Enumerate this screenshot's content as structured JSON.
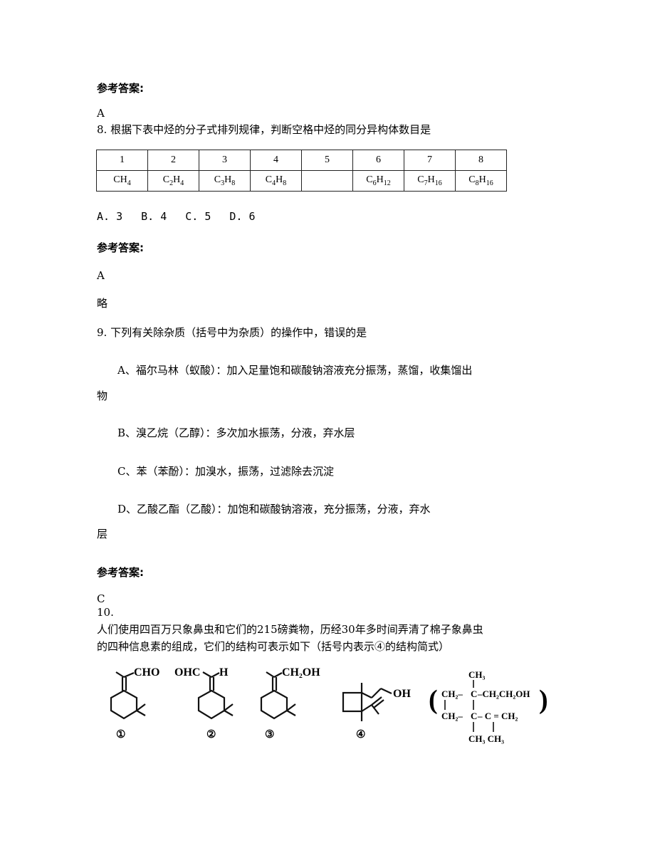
{
  "sections": {
    "ans7": {
      "heading": "参考答案:",
      "answer": "A"
    },
    "q8": {
      "stem": "8. 根据下表中烃的分子式排列规律，判断空格中烃的同分异构体数目是",
      "table": {
        "index_row": [
          "1",
          "2",
          "3",
          "4",
          "5",
          "6",
          "7",
          "8"
        ],
        "formula_row": [
          {
            "base": [
              "C",
              "H"
            ],
            "subs": [
              "",
              "4"
            ]
          },
          {
            "base": [
              "C",
              "H"
            ],
            "subs": [
              "2",
              "4"
            ]
          },
          {
            "base": [
              "C",
              "H"
            ],
            "subs": [
              "3",
              "8"
            ]
          },
          {
            "base": [
              "C",
              "H"
            ],
            "subs": [
              "4",
              "8"
            ]
          },
          null,
          {
            "base": [
              "C",
              "H"
            ],
            "subs": [
              "6",
              "12"
            ]
          },
          {
            "base": [
              "C",
              "H"
            ],
            "subs": [
              "7",
              "16"
            ]
          },
          {
            "base": [
              "C",
              "H"
            ],
            "subs": [
              "8",
              "16"
            ]
          }
        ]
      },
      "options": [
        "A. 3",
        "B. 4",
        "C. 5",
        "D. 6"
      ]
    },
    "ans8": {
      "heading": "参考答案:",
      "answer": "A",
      "note": "略"
    },
    "q9": {
      "stem": "9. 下列有关除杂质（括号中为杂质）的操作中，错误的是",
      "option_a_line1": "A、福尔马林（蚁酸）：加入足量饱和碳酸钠溶液充分振荡，蒸馏，收集馏出",
      "option_a_line2": "物",
      "option_b": "B、溴乙烷（乙醇）：多次加水振荡，分液，弃水层",
      "option_c": "C、苯（苯酚）：加溴水，振荡，过滤除去沉淀",
      "option_d_line1": "D、乙酸乙酯（乙酸）：加饱和碳酸钠溶液，充分振荡，分液，弃水",
      "option_d_line2": "层"
    },
    "ans9": {
      "heading": "参考答案:",
      "answer": "C"
    },
    "q10": {
      "number": "10.",
      "line1": "人们使用四百万只象鼻虫和它们的215磅粪物，历经30年多时间弄清了棉子象鼻虫",
      "line2": "的四种信息素的组成，它们的结构可表示如下（括号内表示④的结构简式）",
      "structures": {
        "s1": {
          "group": "CHO",
          "label": "①"
        },
        "s2": {
          "group_left": "OHC",
          "group_right": "H",
          "label": "②"
        },
        "s3": {
          "group": "CH₂OH",
          "label": "③"
        },
        "s4": {
          "group": "OH",
          "label": "④"
        },
        "condensed": {
          "top_methyl": "CH₃",
          "row1_left": "CH₂–",
          "row1_c": "C",
          "row1_right": "–CH₂CH₂OH",
          "row2_left": "CH₂–",
          "row2_c": "C",
          "row2_mid": "– C = CH₂",
          "bottom": "CH₃ CH₃",
          "paren_open": "(",
          "paren_close": ")"
        }
      }
    }
  }
}
